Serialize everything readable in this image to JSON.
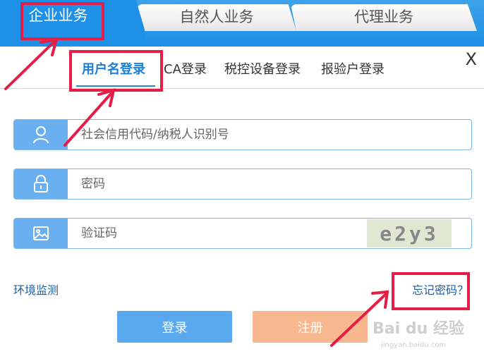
{
  "top_tabs": {
    "enterprise": "企业业务",
    "natural": "自然人业务",
    "agent": "代理业务"
  },
  "sub_tabs": {
    "username": "用户名登录",
    "ca": "CA登录",
    "tax_device": "税控设备登录",
    "inspection": "报验户登录"
  },
  "close": "X",
  "form": {
    "account_placeholder": "社会信用代码/纳税人识别号",
    "password_placeholder": "密码",
    "captcha_placeholder": "验证码",
    "captcha_text": "e2y3"
  },
  "links": {
    "env_check": "环境监测",
    "forgot": "忘记密码？"
  },
  "buttons": {
    "login": "登录",
    "register": "注册"
  },
  "icons": {
    "account": "user-icon",
    "password": "lock-icon",
    "captcha": "image-icon"
  },
  "colors": {
    "primary": "#1e90e8",
    "login_button": "#5aa9ee",
    "register_button": "#f7b88f",
    "annotation": "#e61e45"
  },
  "watermark": {
    "brand": "Bai du 经验",
    "url": "jingyan.baidu.com"
  }
}
